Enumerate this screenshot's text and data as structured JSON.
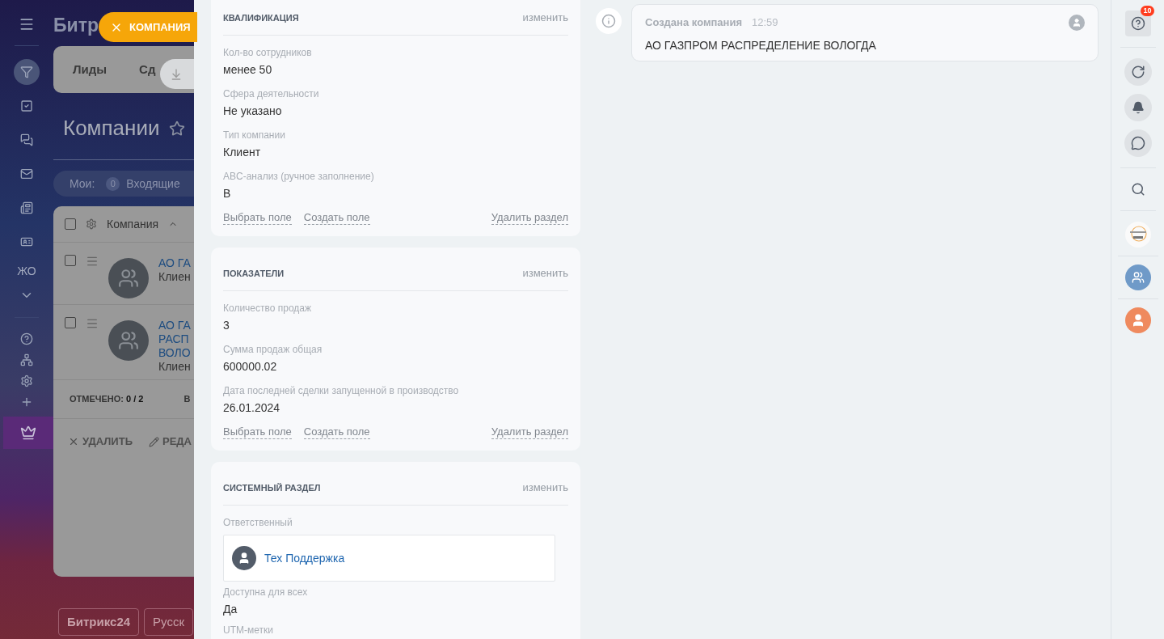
{
  "background_page": {
    "logo": "Битр",
    "nav_text": "ЖО",
    "tabs": [
      {
        "label": "Лиды"
      },
      {
        "label": "Сд"
      }
    ],
    "title": "Компании",
    "filter": {
      "label": "Мои:",
      "count": "0",
      "item": "Входящие"
    },
    "table": {
      "header": "Компания",
      "header_checked": false,
      "rows": [
        {
          "checked": false,
          "name": [
            "АО ГА"
          ],
          "type": "Клиен"
        },
        {
          "checked": false,
          "name": [
            "АО ГА",
            "РАСП",
            "ВОЛО"
          ],
          "type": "Клиен"
        }
      ],
      "footer_label": "ОТМЕЧЕНО:",
      "footer_value": "0 / 2",
      "footer_next": "В"
    },
    "actions": [
      "УДАЛИТЬ",
      "РЕДА"
    ],
    "footer_buttons": [
      "Битрикс24",
      "Русск"
    ]
  },
  "close_button": {
    "label": "КОМПАНИЯ"
  },
  "sections": [
    {
      "title": "КВАЛИФИКАЦИЯ",
      "edit": "изменить",
      "fields": [
        {
          "label": "Кол-во сотрудников",
          "value": "менее 50"
        },
        {
          "label": "Сфера деятельности",
          "value": "Не указано"
        },
        {
          "label": "Тип компании",
          "value": "Клиент"
        },
        {
          "label": "ABC-анализ (ручное заполнение)",
          "value": "B"
        }
      ],
      "actions": [
        "Выбрать поле",
        "Создать поле"
      ],
      "delete": "Удалить раздел"
    },
    {
      "title": "ПОКАЗАТЕЛИ",
      "edit": "изменить",
      "fields": [
        {
          "label": "Количество продаж",
          "value": "3"
        },
        {
          "label": "Сумма продаж общая",
          "value": "600000.02"
        },
        {
          "label": "Дата последней сделки запущенной в производство",
          "value": "26.01.2024"
        }
      ],
      "actions": [
        "Выбрать поле",
        "Создать поле"
      ],
      "delete": "Удалить раздел"
    },
    {
      "title": "СИСТЕМНЫЙ РАЗДЕЛ",
      "edit": "изменить",
      "responsible": {
        "label": "Ответственный",
        "name": "Тех Поддержка"
      },
      "fields": [
        {
          "label": "Доступна для всех",
          "value": "Да"
        },
        {
          "label": "UTM-метки"
        }
      ]
    }
  ],
  "timeline": {
    "title": "Создана компания",
    "time": "12:59",
    "text": "АО ГАЗПРОМ РАСПРЕДЕЛЕНИЕ ВОЛОГДА"
  },
  "right_bar": {
    "help_badge": "10"
  }
}
